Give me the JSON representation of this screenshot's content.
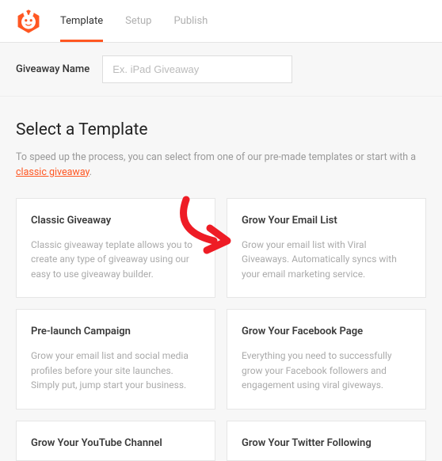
{
  "tabs": {
    "template": "Template",
    "setup": "Setup",
    "publish": "Publish"
  },
  "name_section": {
    "label": "Giveaway Name",
    "placeholder": "Ex. iPad Giveaway"
  },
  "section": {
    "title": "Select a Template",
    "subtitle_pre": "To speed up the process, you can select from one of our pre-made templates or start with a ",
    "subtitle_link": "classic giveaway",
    "subtitle_post": "."
  },
  "templates": [
    {
      "title": "Classic Giveaway",
      "desc": "Classic giveaway teplate allows you to create any type of giveaway using our easy to use giveaway builder."
    },
    {
      "title": "Grow Your Email List",
      "desc": "Grow your email list with Viral Giveaways. Automatically syncs with your email marketing service."
    },
    {
      "title": "Pre-launch Campaign",
      "desc": "Grow your email list and social media profiles before your site launches. Simply put, jump start your business."
    },
    {
      "title": "Grow Your Facebook Page",
      "desc": "Everything you need to successfully grow your Facebook followers and engagement using viral giveways."
    },
    {
      "title": "Grow Your YouTube Channel",
      "desc": ""
    },
    {
      "title": "Grow Your Twitter Following",
      "desc": ""
    }
  ]
}
